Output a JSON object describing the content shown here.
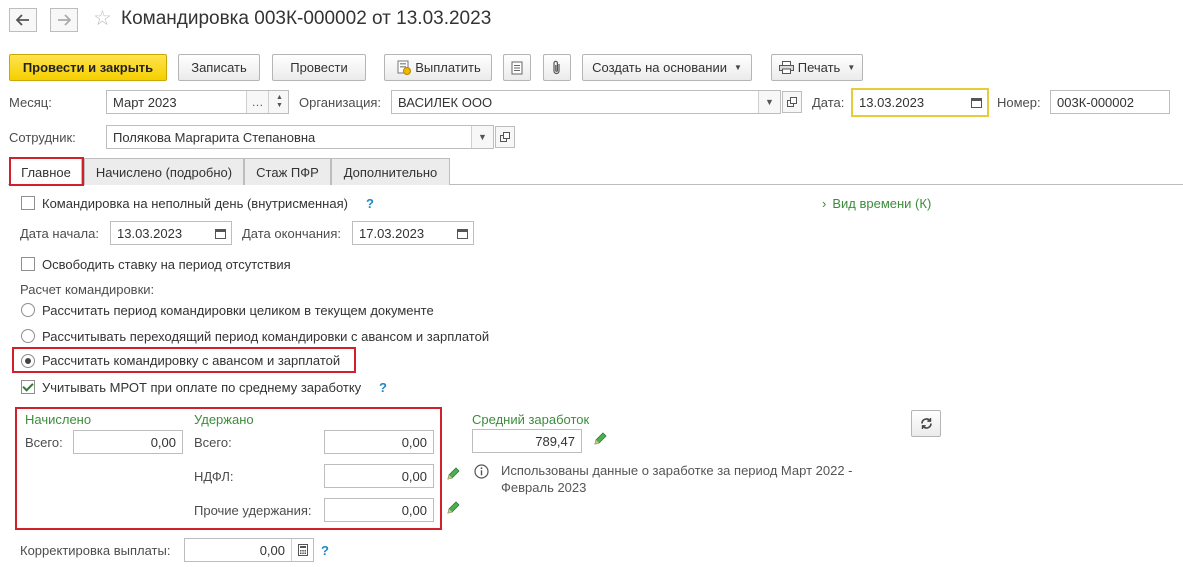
{
  "header": {
    "title": "Командировка 003К-000002 от 13.03.2023",
    "back_icon": "arrow-left-icon",
    "forward_icon": "arrow-right-icon",
    "favorite_icon": "star-icon"
  },
  "toolbar": {
    "post_close": "Провести и закрыть",
    "save": "Записать",
    "post": "Провести",
    "pay": "Выплатить",
    "create_based": "Создать на основании",
    "print": "Печать"
  },
  "form": {
    "month_label": "Месяц:",
    "month_value": "Март 2023",
    "org_label": "Организация:",
    "org_value": "ВАСИЛЕК ООО",
    "date_label": "Дата:",
    "date_value": "13.03.2023",
    "number_label": "Номер:",
    "number_value": "003К-000002",
    "employee_label": "Сотрудник:",
    "employee_value": "Полякова Маргарита Степановна"
  },
  "tabs": [
    {
      "label": "Главное"
    },
    {
      "label": "Начислено (подробно)"
    },
    {
      "label": "Стаж ПФР"
    },
    {
      "label": "Дополнительно"
    }
  ],
  "main": {
    "part_day_label": "Командировка на неполный день (внутрисменная)",
    "help": "?",
    "time_type_label": "Вид времени (К)",
    "start_label": "Дата начала:",
    "start_value": "13.03.2023",
    "end_label": "Дата окончания:",
    "end_value": "17.03.2023",
    "free_rate_label": "Освободить ставку на период отсутствия",
    "calc_label": "Расчет командировки:",
    "radio1": "Рассчитать период командировки целиком в текущем документе",
    "radio2": "Рассчитывать переходящий период командировки с авансом и зарплатой",
    "radio3": "Рассчитать командировку с авансом и зарплатой",
    "mrot_label": "Учитывать МРОТ при оплате по среднему заработку"
  },
  "totals": {
    "accrued_title": "Начислено",
    "withheld_title": "Удержано",
    "total_label": "Всего:",
    "accrued_total": "0,00",
    "withheld_total_label": "Всего:",
    "withheld_total": "0,00",
    "ndfl_label": "НДФЛ:",
    "ndfl_value": "0,00",
    "other_label": "Прочие удержания:",
    "other_value": "0,00",
    "avg_title": "Средний заработок",
    "avg_value": "789,47",
    "info_line1": "Использованы данные о заработке за период Март 2022 -",
    "info_line2": "Февраль 2023",
    "correction_label": "Корректировка выплаты:",
    "correction_value": "0,00"
  },
  "colors": {
    "accent_yellow": "#f5cf00",
    "highlight_red": "#d0202c",
    "green_text": "#3b8d3b",
    "help_blue": "#1e88c8"
  }
}
